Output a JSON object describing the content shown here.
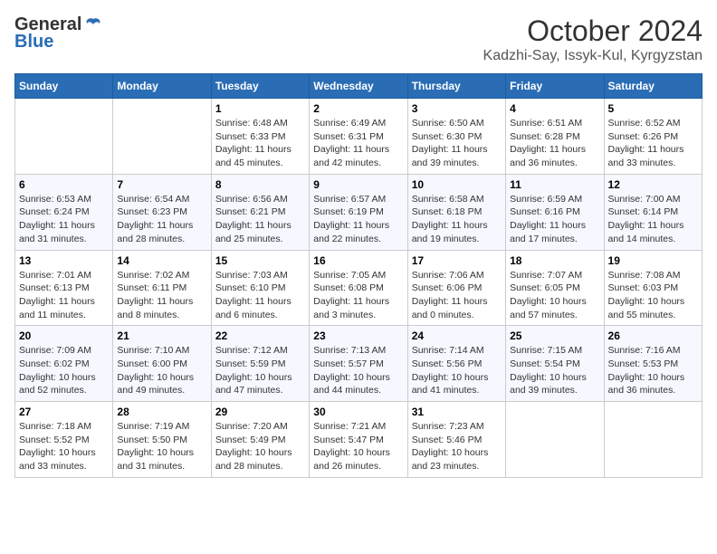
{
  "header": {
    "logo_general": "General",
    "logo_blue": "Blue",
    "month": "October 2024",
    "location": "Kadzhi-Say, Issyk-Kul, Kyrgyzstan"
  },
  "weekdays": [
    "Sunday",
    "Monday",
    "Tuesday",
    "Wednesday",
    "Thursday",
    "Friday",
    "Saturday"
  ],
  "weeks": [
    [
      {
        "day": "",
        "sunrise": "",
        "sunset": "",
        "daylight": ""
      },
      {
        "day": "",
        "sunrise": "",
        "sunset": "",
        "daylight": ""
      },
      {
        "day": "1",
        "sunrise": "Sunrise: 6:48 AM",
        "sunset": "Sunset: 6:33 PM",
        "daylight": "Daylight: 11 hours and 45 minutes."
      },
      {
        "day": "2",
        "sunrise": "Sunrise: 6:49 AM",
        "sunset": "Sunset: 6:31 PM",
        "daylight": "Daylight: 11 hours and 42 minutes."
      },
      {
        "day": "3",
        "sunrise": "Sunrise: 6:50 AM",
        "sunset": "Sunset: 6:30 PM",
        "daylight": "Daylight: 11 hours and 39 minutes."
      },
      {
        "day": "4",
        "sunrise": "Sunrise: 6:51 AM",
        "sunset": "Sunset: 6:28 PM",
        "daylight": "Daylight: 11 hours and 36 minutes."
      },
      {
        "day": "5",
        "sunrise": "Sunrise: 6:52 AM",
        "sunset": "Sunset: 6:26 PM",
        "daylight": "Daylight: 11 hours and 33 minutes."
      }
    ],
    [
      {
        "day": "6",
        "sunrise": "Sunrise: 6:53 AM",
        "sunset": "Sunset: 6:24 PM",
        "daylight": "Daylight: 11 hours and 31 minutes."
      },
      {
        "day": "7",
        "sunrise": "Sunrise: 6:54 AM",
        "sunset": "Sunset: 6:23 PM",
        "daylight": "Daylight: 11 hours and 28 minutes."
      },
      {
        "day": "8",
        "sunrise": "Sunrise: 6:56 AM",
        "sunset": "Sunset: 6:21 PM",
        "daylight": "Daylight: 11 hours and 25 minutes."
      },
      {
        "day": "9",
        "sunrise": "Sunrise: 6:57 AM",
        "sunset": "Sunset: 6:19 PM",
        "daylight": "Daylight: 11 hours and 22 minutes."
      },
      {
        "day": "10",
        "sunrise": "Sunrise: 6:58 AM",
        "sunset": "Sunset: 6:18 PM",
        "daylight": "Daylight: 11 hours and 19 minutes."
      },
      {
        "day": "11",
        "sunrise": "Sunrise: 6:59 AM",
        "sunset": "Sunset: 6:16 PM",
        "daylight": "Daylight: 11 hours and 17 minutes."
      },
      {
        "day": "12",
        "sunrise": "Sunrise: 7:00 AM",
        "sunset": "Sunset: 6:14 PM",
        "daylight": "Daylight: 11 hours and 14 minutes."
      }
    ],
    [
      {
        "day": "13",
        "sunrise": "Sunrise: 7:01 AM",
        "sunset": "Sunset: 6:13 PM",
        "daylight": "Daylight: 11 hours and 11 minutes."
      },
      {
        "day": "14",
        "sunrise": "Sunrise: 7:02 AM",
        "sunset": "Sunset: 6:11 PM",
        "daylight": "Daylight: 11 hours and 8 minutes."
      },
      {
        "day": "15",
        "sunrise": "Sunrise: 7:03 AM",
        "sunset": "Sunset: 6:10 PM",
        "daylight": "Daylight: 11 hours and 6 minutes."
      },
      {
        "day": "16",
        "sunrise": "Sunrise: 7:05 AM",
        "sunset": "Sunset: 6:08 PM",
        "daylight": "Daylight: 11 hours and 3 minutes."
      },
      {
        "day": "17",
        "sunrise": "Sunrise: 7:06 AM",
        "sunset": "Sunset: 6:06 PM",
        "daylight": "Daylight: 11 hours and 0 minutes."
      },
      {
        "day": "18",
        "sunrise": "Sunrise: 7:07 AM",
        "sunset": "Sunset: 6:05 PM",
        "daylight": "Daylight: 10 hours and 57 minutes."
      },
      {
        "day": "19",
        "sunrise": "Sunrise: 7:08 AM",
        "sunset": "Sunset: 6:03 PM",
        "daylight": "Daylight: 10 hours and 55 minutes."
      }
    ],
    [
      {
        "day": "20",
        "sunrise": "Sunrise: 7:09 AM",
        "sunset": "Sunset: 6:02 PM",
        "daylight": "Daylight: 10 hours and 52 minutes."
      },
      {
        "day": "21",
        "sunrise": "Sunrise: 7:10 AM",
        "sunset": "Sunset: 6:00 PM",
        "daylight": "Daylight: 10 hours and 49 minutes."
      },
      {
        "day": "22",
        "sunrise": "Sunrise: 7:12 AM",
        "sunset": "Sunset: 5:59 PM",
        "daylight": "Daylight: 10 hours and 47 minutes."
      },
      {
        "day": "23",
        "sunrise": "Sunrise: 7:13 AM",
        "sunset": "Sunset: 5:57 PM",
        "daylight": "Daylight: 10 hours and 44 minutes."
      },
      {
        "day": "24",
        "sunrise": "Sunrise: 7:14 AM",
        "sunset": "Sunset: 5:56 PM",
        "daylight": "Daylight: 10 hours and 41 minutes."
      },
      {
        "day": "25",
        "sunrise": "Sunrise: 7:15 AM",
        "sunset": "Sunset: 5:54 PM",
        "daylight": "Daylight: 10 hours and 39 minutes."
      },
      {
        "day": "26",
        "sunrise": "Sunrise: 7:16 AM",
        "sunset": "Sunset: 5:53 PM",
        "daylight": "Daylight: 10 hours and 36 minutes."
      }
    ],
    [
      {
        "day": "27",
        "sunrise": "Sunrise: 7:18 AM",
        "sunset": "Sunset: 5:52 PM",
        "daylight": "Daylight: 10 hours and 33 minutes."
      },
      {
        "day": "28",
        "sunrise": "Sunrise: 7:19 AM",
        "sunset": "Sunset: 5:50 PM",
        "daylight": "Daylight: 10 hours and 31 minutes."
      },
      {
        "day": "29",
        "sunrise": "Sunrise: 7:20 AM",
        "sunset": "Sunset: 5:49 PM",
        "daylight": "Daylight: 10 hours and 28 minutes."
      },
      {
        "day": "30",
        "sunrise": "Sunrise: 7:21 AM",
        "sunset": "Sunset: 5:47 PM",
        "daylight": "Daylight: 10 hours and 26 minutes."
      },
      {
        "day": "31",
        "sunrise": "Sunrise: 7:23 AM",
        "sunset": "Sunset: 5:46 PM",
        "daylight": "Daylight: 10 hours and 23 minutes."
      },
      {
        "day": "",
        "sunrise": "",
        "sunset": "",
        "daylight": ""
      },
      {
        "day": "",
        "sunrise": "",
        "sunset": "",
        "daylight": ""
      }
    ]
  ]
}
